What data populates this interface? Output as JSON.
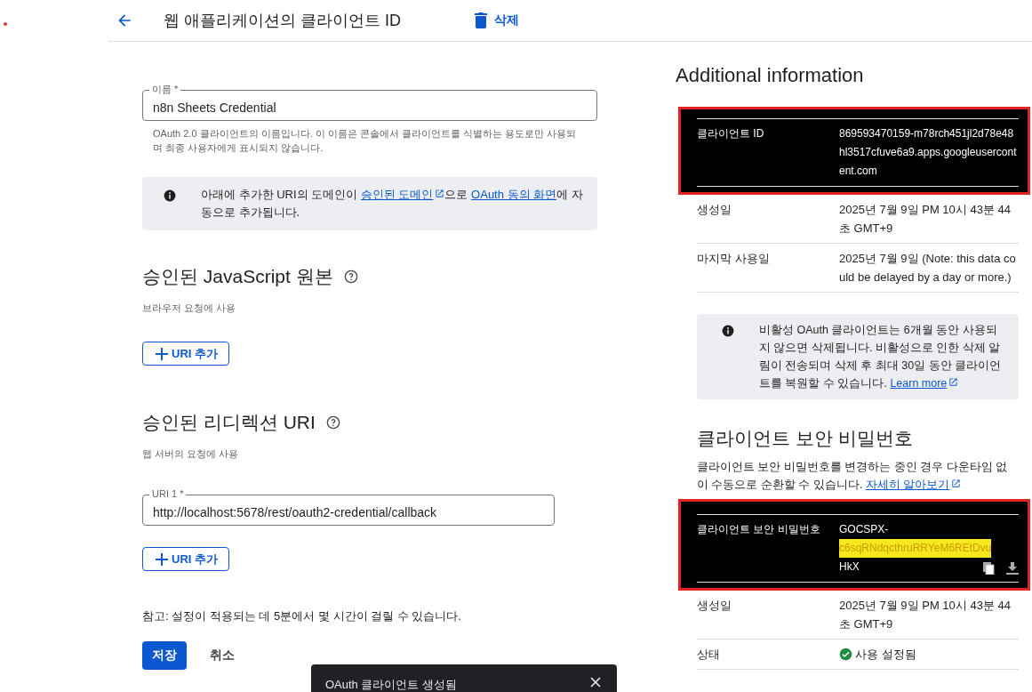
{
  "header": {
    "title": "웹 애플리케이션의 클라이언트 ID",
    "delete_label": "삭제"
  },
  "name_field": {
    "label": "이름 *",
    "value": "n8n Sheets Credential",
    "helper": "OAuth 2.0 클라이언트의 이름입니다. 이 이름은 콘솔에서 클라이언트를 식별하는 용도로만 사용되며 최종 사용자에게 표시되지 않습니다."
  },
  "domain_notice": [
    {
      "text": "아래에 추가한 URI의 도메인이 ",
      "kind": "text"
    },
    {
      "text": "승인된 도메인",
      "kind": "external_link"
    },
    {
      "text": "으로 ",
      "kind": "text"
    },
    {
      "text": "OAuth 동의 화면",
      "kind": "link"
    },
    {
      "text": "에 자동으로 추가됩니다.",
      "kind": "text"
    }
  ],
  "sections": [
    {
      "title": "승인된 JavaScript 원본",
      "subtitle": "브라우저 요청에 사용",
      "add_button": "URI 추가"
    },
    {
      "title": "승인된 리디렉션 URI",
      "subtitle": "웹 서버의 요청에 사용",
      "uris": [
        {
          "label": "URI 1 *",
          "value": "http://localhost:5678/rest/oauth2-credential/callback"
        }
      ],
      "add_button": "URI 추가"
    }
  ],
  "note": "참고: 설정이 적용되는 데 5분에서 몇 시간이 걸릴 수 있습니다.",
  "save_button": "저장",
  "cancel_button": "취소",
  "toast": {
    "text": "OAuth 클라이언트 생성됨"
  },
  "additional": {
    "title": "Additional information",
    "client_id": {
      "label": "클라이언트 ID",
      "value": "869593470159-m78rch451jl2d78e48hl3517cfuve6a9.apps.googleusercontent.com"
    },
    "rows": [
      {
        "label": "생성일",
        "value": "2025년 7월 9일 PM 10시 43분 44초 GMT+9"
      },
      {
        "label": "마지막 사용일",
        "value": "2025년 7월 9일 (Note: this data could be delayed by a day or more.)"
      }
    ],
    "notice": {
      "text": "비활성 OAuth 클라이언트는 6개월 동안 사용되지 않으면 삭제됩니다. 비활성으로 인한 삭제 알림이 전송되며 삭제 후 최대 30일 동안 클라이언트를 복원할 수 있습니다. ",
      "link": "Learn more"
    }
  },
  "secret": {
    "title": "클라이언트 보안 비밀번호",
    "description": "클라이언트 보안 비밀번호를 변경하는 중인 경우 다운타임 없이 수동으로 순환할 수 있습니다. ",
    "link": "자세히 알아보기",
    "label": "클라이언트 보안 비밀번호",
    "value_parts": [
      {
        "text": "GOCSPX-",
        "highlighted": false
      },
      {
        "text": "c6sqRNdqcthruRRYeM6REtDvu",
        "highlighted": true
      },
      {
        "text": "HkX",
        "highlighted": false
      }
    ],
    "rows": [
      {
        "label": "생성일",
        "value": "2025년 7월 9일 PM 10시 43분 44초 GMT+9"
      }
    ],
    "status": {
      "label": "상태",
      "value": "사용 설정됨"
    }
  }
}
